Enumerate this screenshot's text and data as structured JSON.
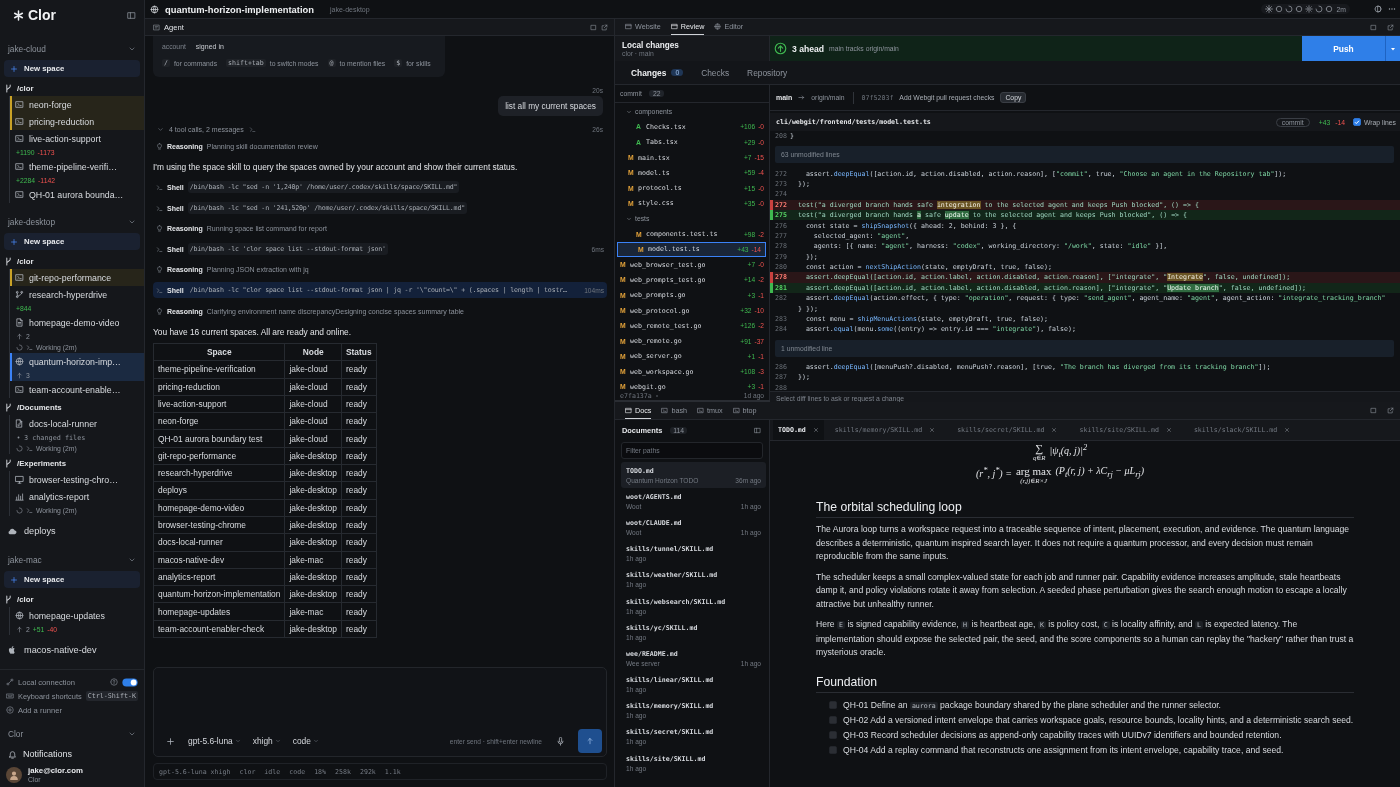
{
  "top_bar": {
    "title": "quantum-horizon-implementation",
    "node": "jake-desktop",
    "elapsed": "2m"
  },
  "sidebar": {
    "brand": "Clor",
    "nodes": [
      {
        "name": "jake-cloud",
        "expanded": true,
        "new_space": "New space",
        "folders": [
          {
            "path": "/clor",
            "spaces": [
              {
                "kind": "terminal",
                "name": "neon-forge",
                "attention": true,
                "selected": false
              },
              {
                "kind": "terminal",
                "name": "pricing-reduction",
                "attention": true,
                "selected": false
              },
              {
                "kind": "terminal",
                "name": "live-action-support",
                "attention": false,
                "selected": false,
                "added": "+1190",
                "removed": "-1173"
              },
              {
                "kind": "terminal",
                "name": "theme-pipeline-verifi…",
                "attention": false,
                "selected": false,
                "added": "+2284",
                "removed": "-1142"
              },
              {
                "kind": "terminal",
                "name": "QH-01 aurora bounda…",
                "attention": false,
                "selected": false
              }
            ]
          }
        ]
      },
      {
        "name": "jake-desktop",
        "expanded": true,
        "new_space": "New space",
        "folders": [
          {
            "path": "/clor",
            "spaces": [
              {
                "kind": "terminal",
                "name": "git-repo-performance",
                "attention": true,
                "selected": false
              },
              {
                "kind": "branch",
                "name": "research-hyperdrive",
                "attention": false,
                "selected": false,
                "added": "+844"
              },
              {
                "kind": "doc",
                "name": "homepage-demo-video",
                "attention": false,
                "selected": false,
                "ahead": "2",
                "working": "Working (2m)"
              },
              {
                "kind": "globe",
                "name": "quantum-horizon-imp…",
                "attention": false,
                "selected": true,
                "ahead": "3"
              },
              {
                "kind": "terminal",
                "name": "team-account-enable…",
                "attention": false,
                "selected": false
              }
            ]
          },
          {
            "path": "/Documents",
            "spaces": [
              {
                "kind": "edit",
                "name": "docs-local-runner",
                "attention": false,
                "selected": false,
                "note": "3 changed files",
                "working": "Working (2m)"
              }
            ]
          },
          {
            "path": "/Experiments",
            "spaces": [
              {
                "kind": "monitor",
                "name": "browser-testing-chro…",
                "attention": false,
                "selected": false
              },
              {
                "kind": "chart",
                "name": "analytics-report",
                "attention": false,
                "selected": false,
                "working": "Working (2m)"
              }
            ]
          }
        ],
        "spaces": [
          {
            "kind": "cloud",
            "name": "deploys",
            "attention": false,
            "selected": false
          }
        ]
      },
      {
        "name": "jake-mac",
        "expanded": true,
        "new_space": "New space",
        "folders": [
          {
            "path": "/clor",
            "spaces": [
              {
                "kind": "globe",
                "name": "homepage-updates",
                "attention": false,
                "selected": false,
                "ahead": "2",
                "added": "+51",
                "removed": "-40"
              }
            ]
          }
        ],
        "spaces": [
          {
            "kind": "apple",
            "name": "macos-native-dev",
            "attention": false,
            "selected": false
          }
        ]
      }
    ],
    "local_connection": {
      "label": "Local connection",
      "on": true
    },
    "shortcuts": {
      "label": "Keyboard shortcuts",
      "keys": "Ctrl-Shift-K"
    },
    "add_runner": "Add a runner",
    "section": {
      "name": "Clor",
      "expanded": true,
      "items": [
        "Notifications"
      ]
    },
    "user": {
      "email": "jake@clor.com",
      "org": "Clor"
    }
  },
  "agent": {
    "title": "Agent",
    "info": {
      "account_label": "account",
      "account_value": "signed in",
      "hints": [
        {
          "key": "/",
          "text": "for commands"
        },
        {
          "key": "shift+tab",
          "text": "to switch modes"
        },
        {
          "key": "@",
          "text": "to mention files"
        },
        {
          "key": "$",
          "text": "for skills"
        }
      ]
    },
    "user_message": {
      "time": "20s",
      "text": "list all my current spaces"
    },
    "summary": {
      "expanded": true,
      "text": "4 tool calls, 2 messages",
      "time": "26s"
    },
    "steps": [
      {
        "kind": "reasoning",
        "label": "Reasoning",
        "text": "Planning skill documentation review"
      },
      {
        "kind": "message",
        "text": "I'm using the space skill to query the spaces owned by your account and show their current status."
      },
      {
        "kind": "shell",
        "label": "Shell",
        "command": "/bin/bash -lc \"sed -n '1,240p' /home/user/.codex/skills/space/SKILL.md\"",
        "selected": false
      },
      {
        "kind": "shell",
        "label": "Shell",
        "command": "/bin/bash -lc \"sed -n '241,520p' /home/user/.codex/skills/space/SKILL.md\"",
        "selected": false
      },
      {
        "kind": "reasoning",
        "label": "Reasoning",
        "text": "Running space list command for report"
      },
      {
        "kind": "shell",
        "label": "Shell",
        "command": "/bin/bash -lc 'clor space list --stdout-format json'",
        "time": "6ms",
        "selected": false
      },
      {
        "kind": "reasoning",
        "label": "Reasoning",
        "text": "Planning JSON extraction with jq"
      },
      {
        "kind": "shell",
        "label": "Shell",
        "command": "/bin/bash -lc \"clor space list --stdout-format json | jq -r '\\\"count=\\\" + (.spaces | length | tostr…",
        "time": "104ms",
        "selected": true
      },
      {
        "kind": "reasoning",
        "label": "Reasoning",
        "text": "Clarifying environment name discrepancyDesigning concise spaces summary table"
      },
      {
        "kind": "message",
        "text": "You have 16 current spaces. All are ready and online."
      }
    ],
    "table": {
      "columns": [
        "Space",
        "Node",
        "Status"
      ],
      "rows": [
        [
          "theme-pipeline-verification",
          "jake-cloud",
          "ready"
        ],
        [
          "pricing-reduction",
          "jake-cloud",
          "ready"
        ],
        [
          "live-action-support",
          "jake-cloud",
          "ready"
        ],
        [
          "neon-forge",
          "jake-cloud",
          "ready"
        ],
        [
          "QH-01 aurora boundary test",
          "jake-cloud",
          "ready"
        ],
        [
          "git-repo-performance",
          "jake-desktop",
          "ready"
        ],
        [
          "research-hyperdrive",
          "jake-desktop",
          "ready"
        ],
        [
          "deploys",
          "jake-desktop",
          "ready"
        ],
        [
          "homepage-demo-video",
          "jake-desktop",
          "ready"
        ],
        [
          "browser-testing-chrome",
          "jake-desktop",
          "ready"
        ],
        [
          "docs-local-runner",
          "jake-desktop",
          "ready"
        ],
        [
          "macos-native-dev",
          "jake-mac",
          "ready"
        ],
        [
          "analytics-report",
          "jake-desktop",
          "ready"
        ],
        [
          "quantum-horizon-implementation",
          "jake-desktop",
          "ready"
        ],
        [
          "homepage-updates",
          "jake-mac",
          "ready"
        ],
        [
          "team-account-enabler-check",
          "jake-desktop",
          "ready"
        ]
      ]
    },
    "composer": {
      "model": "gpt-5.6-luna",
      "effort": "xhigh",
      "mode": "code",
      "hint": "enter send · shift+enter newline"
    },
    "status_bar": [
      "gpt-5.6-luna xhigh",
      "clor",
      "idle",
      "code",
      "18%",
      "258k",
      "292k",
      "1.1k"
    ]
  },
  "right_tabs": [
    {
      "label": "Website",
      "selected": false
    },
    {
      "label": "Review",
      "selected": true
    },
    {
      "label": "Editor",
      "selected": false
    }
  ],
  "review": {
    "title": "Local changes",
    "subtitle": "clor · main",
    "ahead": "3 ahead",
    "tracking": "main tracks origin/main",
    "push": "Push",
    "tabs": [
      {
        "label": "Changes",
        "badge": "0",
        "selected": true
      },
      {
        "label": "Checks",
        "selected": false
      },
      {
        "label": "Repository",
        "selected": false
      }
    ],
    "tree": {
      "label": "commit",
      "count": "22",
      "items": [
        {
          "kind": "folder",
          "children": [
            {
              "kind": "folder",
              "name": "components",
              "expanded": true,
              "children": [
                {
                  "kind": "added",
                  "status": "A",
                  "name": "Checks.tsx",
                  "added": "+106",
                  "removed": "-0",
                  "selected": false
                },
                {
                  "kind": "added",
                  "status": "A",
                  "name": "Tabs.tsx",
                  "added": "+29",
                  "removed": "-0",
                  "selected": false
                }
              ]
            },
            {
              "kind": "modified",
              "status": "M",
              "name": "main.tsx",
              "added": "+7",
              "removed": "-15",
              "selected": false
            },
            {
              "kind": "modified",
              "status": "M",
              "name": "model.ts",
              "added": "+59",
              "removed": "-4",
              "selected": false
            },
            {
              "kind": "modified",
              "status": "M",
              "name": "protocol.ts",
              "added": "+15",
              "removed": "-0",
              "selected": false
            },
            {
              "kind": "modified",
              "status": "M",
              "name": "style.css",
              "added": "+35",
              "removed": "-0",
              "selected": false
            },
            {
              "kind": "folder",
              "name": "tests",
              "expanded": true,
              "children": [
                {
                  "kind": "modified",
                  "status": "M",
                  "name": "components.test.ts",
                  "added": "+98",
                  "removed": "-2",
                  "selected": false
                },
                {
                  "kind": "modified",
                  "status": "M",
                  "name": "model.test.ts",
                  "added": "+43",
                  "removed": "-14",
                  "selected": true
                }
              ]
            }
          ]
        },
        {
          "kind": "modified",
          "status": "M",
          "name": "web_browser_test.go",
          "added": "+7",
          "removed": "-0",
          "selected": false
        },
        {
          "kind": "modified",
          "status": "M",
          "name": "web_prompts_test.go",
          "added": "+14",
          "removed": "-2",
          "selected": false
        },
        {
          "kind": "modified",
          "status": "M",
          "name": "web_prompts.go",
          "added": "+3",
          "removed": "-1",
          "selected": false
        },
        {
          "kind": "modified",
          "status": "M",
          "name": "web_protocol.go",
          "added": "+32",
          "removed": "-10",
          "selected": false
        },
        {
          "kind": "modified",
          "status": "M",
          "name": "web_remote_test.go",
          "added": "+126",
          "removed": "-2",
          "selected": false
        },
        {
          "kind": "modified",
          "status": "M",
          "name": "web_remote.go",
          "added": "+91",
          "removed": "-37",
          "selected": false
        },
        {
          "kind": "modified",
          "status": "M",
          "name": "web_server.go",
          "added": "+1",
          "removed": "-1",
          "selected": false
        },
        {
          "kind": "modified",
          "status": "M",
          "name": "web_workspace.go",
          "added": "+108",
          "removed": "-3",
          "selected": false
        },
        {
          "kind": "modified",
          "status": "M",
          "name": "webgit.go",
          "added": "+3",
          "removed": "-1",
          "selected": false
        }
      ],
      "footer_hash": "e7fa137a",
      "footer_time": "1d ago"
    },
    "diff": {
      "branch": "main",
      "upstream": "origin/main",
      "hash": "07f5203f",
      "message": "Add Webgit pull request checks",
      "copy": "Copy",
      "file": "cli/webgit/frontend/tests/model.test.ts",
      "badge": "commit",
      "added": "+43",
      "removed": "-14",
      "wrap": {
        "label": "Wrap lines",
        "checked": true
      },
      "lines": [
        {
          "kind": "context",
          "number": "208",
          "text": "}"
        },
        {
          "kind": "fold",
          "text": "63 unmodified lines"
        },
        {
          "kind": "context",
          "number": "272",
          "text": "    assert.deepEqual([action.id, action.disabled, action.reason], [\"commit\", true, \"Choose an agent in the Repository tab\"]);"
        },
        {
          "kind": "context",
          "number": "273",
          "text": "  });"
        },
        {
          "kind": "context",
          "number": "274"
        },
        {
          "kind": "removed",
          "number": "272",
          "parts": [
            {
              "text": "  test(\"a diverged branch hands safe ",
              "changed": false
            },
            {
              "text": "integration",
              "changed": true
            },
            {
              "text": " to the selected agent and keeps Push blocked\", () => {",
              "changed": false
            }
          ]
        },
        {
          "kind": "added",
          "number": "275",
          "parts": [
            {
              "text": "  test(\"a diverged branch hands ",
              "changed": false
            },
            {
              "text": "a",
              "changed": true
            },
            {
              "text": " safe ",
              "changed": false
            },
            {
              "text": "update",
              "changed": true
            },
            {
              "text": " to the selected agent and keeps Push blocked\", () => {",
              "changed": false
            }
          ]
        },
        {
          "kind": "context",
          "number": "276",
          "text": "    const state = shipSnapshot({ ahead: 2, behind: 3 }, {"
        },
        {
          "kind": "context",
          "number": "277",
          "text": "      selected_agent: \"agent\","
        },
        {
          "kind": "context",
          "number": "278",
          "text": "      agents: [{ name: \"agent\", harness: \"codex\", working_directory: \"/work\", state: \"idle\" }],"
        },
        {
          "kind": "context",
          "number": "279",
          "text": "    });"
        },
        {
          "kind": "context",
          "number": "280",
          "text": "    const action = nextShipAction(state, emptyDraft, true, false);"
        },
        {
          "kind": "removed",
          "number": "278",
          "parts": [
            {
              "text": "    assert.deepEqual([action.id, action.label, action.disabled, action.reason], [\"integrate\", \"",
              "changed": false
            },
            {
              "text": "Integrate",
              "changed": true
            },
            {
              "text": "\", false, undefined]);",
              "changed": false
            }
          ]
        },
        {
          "kind": "added",
          "number": "281",
          "parts": [
            {
              "text": "    assert.deepEqual([action.id, action.label, action.disabled, action.reason], [\"integrate\", \"",
              "changed": false
            },
            {
              "text": "Update branch",
              "changed": true
            },
            {
              "text": "\", false, undefined]);",
              "changed": false
            }
          ]
        },
        {
          "kind": "context",
          "number": "282",
          "text": "    assert.deepEqual(action.effect, { type: \"operation\", request: { type: \"send_agent\", agent_name: \"agent\", agent_action: \"integrate_tracking_branch\"",
          "continuation": "} });"
        },
        {
          "kind": "context",
          "number": "283",
          "text": "    const menu = shipMenuActions(state, emptyDraft, true, false);"
        },
        {
          "kind": "context",
          "number": "284",
          "text": "    assert.equal(menu.some((entry) => entry.id === \"integrate\"), false);"
        },
        {
          "kind": "fold",
          "text": "1 unmodified line"
        },
        {
          "kind": "context",
          "number": "286",
          "text": "    assert.deepEqual([menuPush?.disabled, menuPush?.reason], [true, \"The branch has diverged from its tracking branch\"]);"
        },
        {
          "kind": "context",
          "number": "287",
          "text": "  });"
        },
        {
          "kind": "context",
          "number": "288"
        }
      ],
      "footer": "Select diff lines to ask or request a change"
    }
  },
  "bottom_tabs": [
    {
      "label": "Docs",
      "selected": true
    },
    {
      "label": "bash",
      "selected": false
    },
    {
      "label": "tmux",
      "selected": false
    },
    {
      "label": "btop",
      "selected": false
    }
  ],
  "documents": {
    "title": "Documents",
    "count": "114",
    "filter_placeholder": "Filter paths",
    "items": [
      {
        "path": "TODO.md",
        "title": "Quantum Horizon TODO",
        "time": "36m ago",
        "selected": true
      },
      {
        "path": "woot/AGENTS.md",
        "title": "Woot",
        "time": "1h ago",
        "selected": false
      },
      {
        "path": "woot/CLAUDE.md",
        "title": "Woot",
        "time": "1h ago",
        "selected": false
      },
      {
        "path": "skills/tunnel/SKILL.md",
        "time": "1h ago",
        "selected": false
      },
      {
        "path": "skills/weather/SKILL.md",
        "time": "1h ago",
        "selected": false
      },
      {
        "path": "skills/websearch/SKILL.md",
        "time": "1h ago",
        "selected": false
      },
      {
        "path": "skills/yc/SKILL.md",
        "time": "1h ago",
        "selected": false
      },
      {
        "path": "wee/README.md",
        "title": "Wee server",
        "time": "1h ago",
        "selected": false
      },
      {
        "path": "skills/linear/SKILL.md",
        "time": "1h ago",
        "selected": false
      },
      {
        "path": "skills/memory/SKILL.md",
        "time": "1h ago",
        "selected": false
      },
      {
        "path": "skills/secret/SKILL.md",
        "time": "1h ago",
        "selected": false
      },
      {
        "path": "skills/site/SKILL.md",
        "time": "1h ago",
        "selected": false
      }
    ]
  },
  "editor": {
    "tabs": [
      {
        "label": "TODO.md",
        "selected": true
      },
      {
        "label": "skills/memory/SKILL.md",
        "selected": false
      },
      {
        "label": "skills/secret/SKILL.md",
        "selected": false
      },
      {
        "label": "skills/site/SKILL.md",
        "selected": false
      },
      {
        "label": "skills/slack/SKILL.md",
        "selected": false
      }
    ],
    "formulas": [
      {
        "operator": "∑",
        "limits": "q∈R",
        "body": "|ψ$_{t}$(q, j)|$^{2}$"
      },
      {
        "lead": "(r$^{*}$, j$^{*}$) =",
        "operator": "arg max",
        "limits": "(r,j)∈R×J",
        "body": "(P$_{t}$(r, j) + λC$_{rj}$ − μL$_{rj}$)"
      }
    ],
    "blocks": [
      {
        "kind": "heading",
        "text": "The orbital scheduling loop"
      },
      {
        "kind": "paragraph",
        "parts": [
          {
            "text": "The Aurora loop turns a workspace request into a traceable sequence of intent, placement, execution, and evidence. The quantum language describes a deterministic, quantum inspired search layer. It does not require a quantum processor, and every decision must remain reproducible from the same inputs."
          }
        ]
      },
      {
        "kind": "paragraph",
        "parts": [
          {
            "text": "The scheduler keeps a small complex-valued state for each job and runner pair. Capability evidence increases amplitude, stale heartbeats damp it, and policy violations rotate it away from selection. A seeded phase perturbation gives the search enough motion to escape a locally attractive but unhealthy runner."
          }
        ]
      },
      {
        "kind": "paragraph",
        "parts": [
          {
            "text": "Here "
          },
          {
            "code": "E"
          },
          {
            "text": " is signed capability evidence, "
          },
          {
            "code": "H"
          },
          {
            "text": " is heartbeat age, "
          },
          {
            "code": "K"
          },
          {
            "text": " is policy cost, "
          },
          {
            "code": "C"
          },
          {
            "text": " is locality affinity, and "
          },
          {
            "code": "L"
          },
          {
            "text": " is expected latency. The implementation should expose the selected pair, the seed, and the score components so a human can replay the \"hackery\" rather than trust a mysterious oracle."
          }
        ]
      },
      {
        "kind": "heading",
        "text": "Foundation"
      },
      {
        "kind": "task",
        "checked": false,
        "parts": [
          {
            "text": "QH-01 Define an "
          },
          {
            "code": "aurora"
          },
          {
            "text": " package boundary shared by the plane scheduler and the runner selector."
          }
        ]
      },
      {
        "kind": "task",
        "checked": false,
        "parts": [
          {
            "text": "QH-02 Add a versioned intent envelope that carries workspace goals, resource bounds, locality hints, and a deterministic search seed."
          }
        ]
      },
      {
        "kind": "task",
        "checked": false,
        "parts": [
          {
            "text": "QH-03 Record scheduler decisions as append-only capability traces with UUIDv7 identifiers and bounded retention."
          }
        ]
      },
      {
        "kind": "task",
        "checked": false,
        "parts": [
          {
            "text": "QH-04 Add a replay command that reconstructs one assignment from its intent envelope, capability trace, and seed."
          }
        ]
      }
    ]
  }
}
